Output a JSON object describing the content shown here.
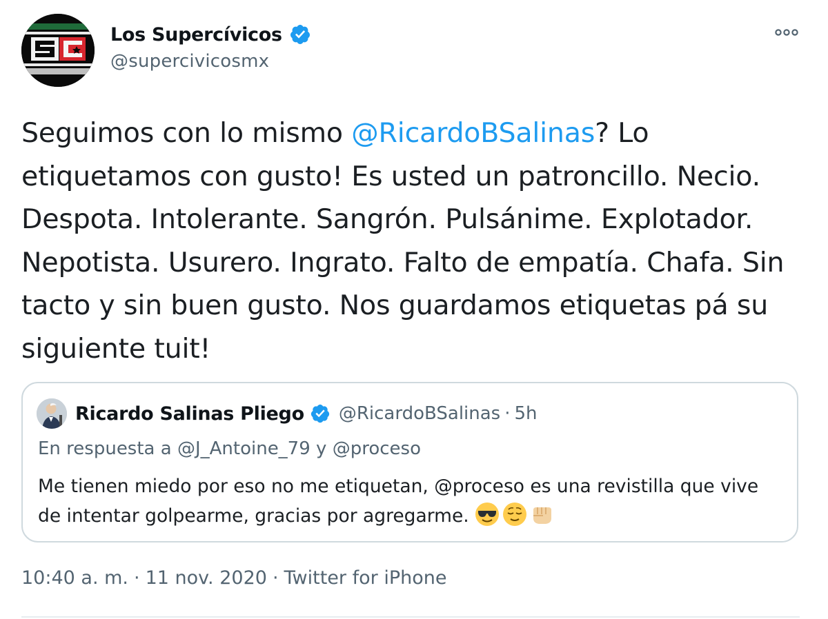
{
  "author": {
    "display_name": "Los Supercívicos",
    "handle": "@supercivicosmx",
    "avatar_text": "SC"
  },
  "tweet": {
    "text_before_mention": "Seguimos con lo mismo ",
    "mention": "@RicardoBSalinas",
    "text_after_mention": "? Lo etiquetamos con gusto! Es usted un patroncillo. Necio. Despota. Intolerante. Sangrón. Pulsánime. Explotador. Nepotista. Usurero. Ingrato. Falto de empatía. Chafa. Sin tacto y sin buen gusto. Nos guardamos etiquetas pá su siguiente tuit!"
  },
  "quoted": {
    "display_name": "Ricardo Salinas Pliego",
    "handle": "@RicardoBSalinas",
    "separator": "·",
    "time": "5h",
    "reply_prefix": "En respuesta a",
    "reply_mention_1": "@J_Antoine_79",
    "reply_conjunction": "y",
    "reply_mention_2": "@proceso",
    "text": "Me tienen miedo por eso no me etiquetan, @proceso es una revistilla que vive de intentar golpearme, gracias por agregarme.",
    "emojis": [
      "sunglasses-emoji",
      "relieved-face-emoji",
      "fist-emoji"
    ]
  },
  "meta": {
    "time": "10:40 a. m.",
    "separator": "·",
    "date": "11 nov. 2020",
    "source": "Twitter for iPhone"
  },
  "colors": {
    "link": "#1d9bf0",
    "secondary_text": "#536471",
    "verified": "#1d9bf0",
    "border": "#cfd9de"
  },
  "icons": {
    "verified": "verified-badge-icon",
    "more": "more-horizontal-icon"
  }
}
